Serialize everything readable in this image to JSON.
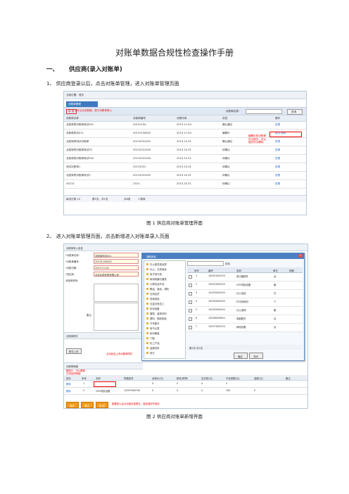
{
  "doc": {
    "title": "对账单数据合规性检查操作手册",
    "section1": {
      "number": "一、",
      "title": "供应商(录入对账单)"
    },
    "step1": "1、 供应商登录以后，点击对账单管理，进入对账单管理页面",
    "fig1_caption": "图 1  供应商对账单管理界面",
    "step2": "2、 进入对账单管理页面，点击新增进入对账单录入页面",
    "fig2_caption": "图 2  供应商对账单新增界面"
  },
  "shot1": {
    "breadcrumb": "当前位置：首页",
    "tab": "对账单管理",
    "add_button": "新 增",
    "add_note": "可以点击新增，进行对账单录入",
    "search_label": "对账单名称：",
    "query_button": "查询",
    "columns": [
      "对账单名称",
      "对账单编号",
      "对账时间",
      "状态",
      "操作"
    ],
    "rows": [
      {
        "name": "北辰商贸对账单测试001",
        "no": "20131104",
        "date": "2013-11-04",
        "status": "确认通过",
        "op": "查看"
      },
      {
        "name": "对账单测试011",
        "no": "20131104002",
        "date": "2013-11-04",
        "status": "编辑中",
        "op": "提交 删除"
      },
      {
        "name": "北辰商贸测试对账单",
        "no": "20131031001",
        "date": "2013-10-31",
        "status": "确认通过",
        "op": "查看"
      },
      {
        "name": "北辰商贸对账单测试03",
        "no": "20131031003",
        "date": "2013-10-31",
        "status": "待确认",
        "op": "查看"
      },
      {
        "name": "北辰商贸对账单测试004",
        "no": "20131031004",
        "date": "2013-10-31",
        "status": "待确认",
        "op": "查看"
      },
      {
        "name": "测试对账单1",
        "no": "20131031",
        "date": "2013-10-31",
        "status": "待确认",
        "op": "查看"
      },
      {
        "name": "北辰商贸对账单测试2",
        "no": "20131031002",
        "date": "2013-10-31",
        "status": "待确认",
        "op": "查看"
      },
      {
        "name": "43214",
        "no": "2314",
        "date": "2013-10-31",
        "status": "待确认",
        "op": "查看"
      }
    ],
    "edit_callout": "编辑中的对账单可以提交，可以提交可以删除",
    "pager": {
      "per_page": "每页行数 10",
      "page": "第1页，共1页",
      "total": "共8条",
      "goto": "1 跳转"
    }
  },
  "shot2": {
    "header": "对账单录入信息",
    "fields": [
      {
        "label": "*对账单名称：",
        "value": "对账单测试001"
      },
      {
        "label": "*对账单编号：",
        "value": "20131104002"
      },
      {
        "label": "*对账日期：",
        "value": "2013-11-04"
      },
      {
        "label": "*供应商：",
        "value": "北京北辰商贸有限公司"
      },
      {
        "label": "对账单说明：",
        "value": ""
      }
    ],
    "remark_label": "备注：",
    "attachment_section": "对账单附件",
    "upload_button": "附件上传",
    "upload_note": "点击此处上传对账单附件",
    "detail_section": "对账单明细",
    "table_columns": [
      "操作",
      "序号",
      "名称",
      "规格型号",
      "含税价(元)",
      "税收(税率)",
      "应交税(元)",
      "不含税额(元)",
      "金额(元)",
      "备注"
    ],
    "table_rows": [
      {
        "op": "删除",
        "seq": "1",
        "name": "",
        "spec": "",
        "price": "0",
        "tax": "0",
        "tax_due": "0",
        "notax": "0",
        "amount": "",
        "remark": ""
      },
      {
        "op": "删除",
        "seq": "2",
        "name": "GPS导航设备",
        "spec": "1393*560*56",
        "price": "0",
        "tax": "0",
        "tax_due": "0",
        "notax": "165",
        "amount": "0",
        "remark": ""
      }
    ],
    "row_note": "删除行：可以删除已添加的明细",
    "buttons": [
      "保存",
      "提交",
      "返 回"
    ],
    "button_note": "数据录入后点击保存或提交，若返回则不保存"
  },
  "dialog": {
    "title": "选取商品",
    "search_button": "查找",
    "tree": [
      "办公家具用品类",
      "办公、文具用品",
      "电子电气类",
      "家用电器与器具",
      "计算机及外设",
      "粮油、食品、调料",
      "日用百货",
      "劳保用品",
      "五金交电化工",
      "机电设备",
      "建筑、装饰材料",
      "塑料、橡胶制品",
      "汽车配件",
      "电气仪表",
      "纺织服装",
      "门窗",
      "化工产品",
      "金属材料",
      "其它"
    ],
    "columns": [
      "序号",
      "编号",
      "名称",
      "单位",
      "规格"
    ],
    "rows": [
      {
        "seq": "1",
        "code": "10001000100",
        "name": "显示器配件",
        "unit": "台"
      },
      {
        "seq": "2",
        "code": "10002000200",
        "name": "GPS导航设备",
        "unit": "套"
      },
      {
        "seq": "3",
        "code": "10003000300",
        "name": "办公用品",
        "unit": "件"
      },
      {
        "seq": "4",
        "code": "10004000400",
        "name": "打印机耗材",
        "unit": "个"
      },
      {
        "seq": "5",
        "code": "10005000500",
        "name": "办公桌椅",
        "unit": "套"
      },
      {
        "seq": "6",
        "code": "10006000600",
        "name": "电脑配件",
        "unit": "台"
      },
      {
        "seq": "7",
        "code": "10007000700",
        "name": "网络设备",
        "unit": "台"
      }
    ],
    "pager": "第1页 共2页",
    "buttons": [
      "确定",
      "关闭"
    ]
  }
}
